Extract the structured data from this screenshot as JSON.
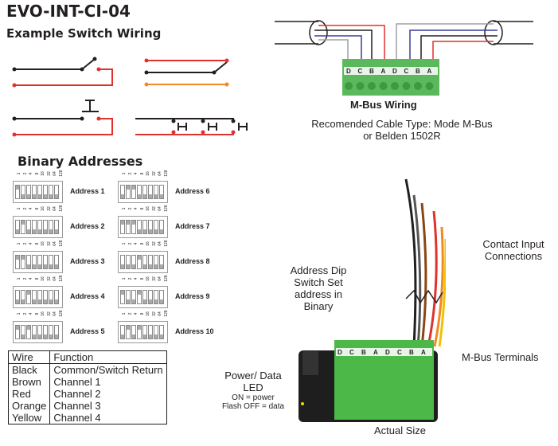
{
  "title": "EVO-INT-CI-04",
  "subtitle": "Example Switch Wiring",
  "binary": {
    "heading": "Binary Addresses",
    "bit_labels": [
      "1",
      "2",
      "4",
      "8",
      "16",
      "32",
      "64",
      "128"
    ],
    "addresses": [
      {
        "label": "Address 1",
        "value": 1
      },
      {
        "label": "Address 2",
        "value": 2
      },
      {
        "label": "Address 3",
        "value": 3
      },
      {
        "label": "Address 4",
        "value": 4
      },
      {
        "label": "Address 5",
        "value": 5
      },
      {
        "label": "Address 6",
        "value": 6
      },
      {
        "label": "Address 7",
        "value": 7
      },
      {
        "label": "Address 8",
        "value": 8
      },
      {
        "label": "Address 9",
        "value": 9
      },
      {
        "label": "Address 10",
        "value": 10
      }
    ]
  },
  "wire_table": {
    "headers": [
      "Wire",
      "Function"
    ],
    "rows": [
      [
        "Black",
        "Common/Switch Return"
      ],
      [
        "Brown",
        "Channel 1"
      ],
      [
        "Red",
        "Channel 2"
      ],
      [
        "Orange",
        "Channel 3"
      ],
      [
        "Yellow",
        "Channel 4"
      ]
    ]
  },
  "mbus": {
    "title": "M-Bus Wiring",
    "cable_line1": "Recomended Cable Type: Mode M-Bus",
    "cable_line2": "or Belden 1502R",
    "terminal_letters": [
      "D",
      "C",
      "B",
      "A",
      "D",
      "C",
      "B",
      "A"
    ]
  },
  "device": {
    "contact_inputs": "Contact Input Connections",
    "dip_label": "Address Dip Switch Set address in Binary",
    "terminals": "M-Bus Terminals",
    "led_title": "Power/ Data LED",
    "led_on": "ON = power",
    "led_flash": "Flash OFF = data",
    "actual_size": "Actual Size"
  },
  "colors": {
    "black": "#231f20",
    "red": "#e0312f",
    "orange": "#f08a24",
    "green": "#4cb848",
    "blue": "#3b3b9a",
    "gray": "#a0a0a0"
  }
}
